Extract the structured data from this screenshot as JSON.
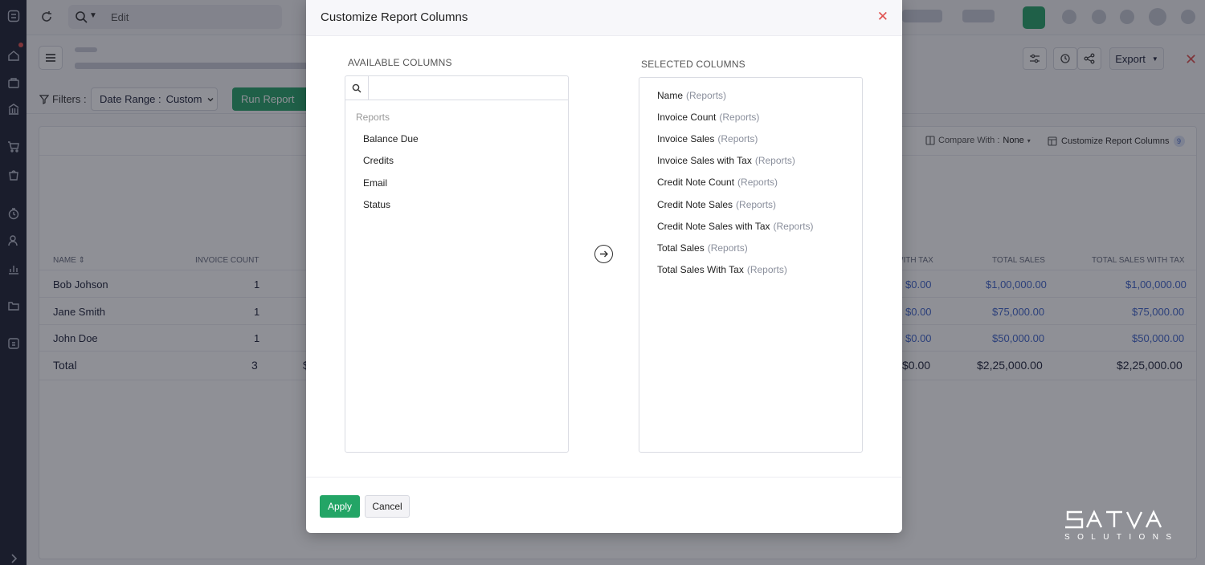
{
  "topbar": {
    "search_edit_label": "Edit"
  },
  "header": {
    "export_label": "Export"
  },
  "filters": {
    "label": "Filters :",
    "date_range_label": "Date Range :",
    "date_range_value": "Custom",
    "run_report_label": "Run Report"
  },
  "report": {
    "compare_label": "Compare With :",
    "compare_value": "None",
    "customize_label": "Customize Report Columns",
    "customize_count": "9",
    "columns": [
      "NAME",
      "INVOICE COUNT",
      "WITH TAX",
      "TOTAL SALES",
      "TOTAL SALES WITH TAX"
    ],
    "rows": [
      {
        "name": "Bob Johson",
        "invoice_count": "1",
        "with_tax": "$0.00",
        "total_sales": "$1,00,000.00",
        "total_sales_with_tax": "$1,00,000.00"
      },
      {
        "name": "Jane Smith",
        "invoice_count": "1",
        "with_tax": "$0.00",
        "total_sales": "$75,000.00",
        "total_sales_with_tax": "$75,000.00"
      },
      {
        "name": "John Doe",
        "invoice_count": "1",
        "with_tax": "$0.00",
        "total_sales": "$50,000.00",
        "total_sales_with_tax": "$50,000.00"
      }
    ],
    "total": {
      "label": "Total",
      "invoice_count": "3",
      "partial": "$",
      "with_tax": "$0.00",
      "total_sales": "$2,25,000.00",
      "total_sales_with_tax": "$2,25,000.00"
    }
  },
  "modal": {
    "title": "Customize Report Columns",
    "available_label": "AVAILABLE COLUMNS",
    "selected_label": "SELECTED COLUMNS",
    "search_placeholder": "",
    "available_group": "Reports",
    "available_items": [
      "Balance Due",
      "Credits",
      "Email",
      "Status"
    ],
    "selected_items": [
      {
        "name": "Name",
        "group": "(Reports)"
      },
      {
        "name": "Invoice Count",
        "group": "(Reports)"
      },
      {
        "name": "Invoice Sales",
        "group": "(Reports)"
      },
      {
        "name": "Invoice Sales with Tax",
        "group": "(Reports)"
      },
      {
        "name": "Credit Note Count",
        "group": "(Reports)"
      },
      {
        "name": "Credit Note Sales",
        "group": "(Reports)"
      },
      {
        "name": "Credit Note Sales with Tax",
        "group": "(Reports)"
      },
      {
        "name": "Total Sales",
        "group": "(Reports)"
      },
      {
        "name": "Total Sales With Tax",
        "group": "(Reports)"
      }
    ],
    "apply_label": "Apply",
    "cancel_label": "Cancel"
  },
  "watermark": {
    "line1": "SATVA",
    "line2": "SOLUTIONS"
  },
  "colors": {
    "accent_green": "#23a566",
    "link_blue": "#4267cb",
    "close_red": "#e0524f",
    "nav_bg": "#1f2434"
  }
}
